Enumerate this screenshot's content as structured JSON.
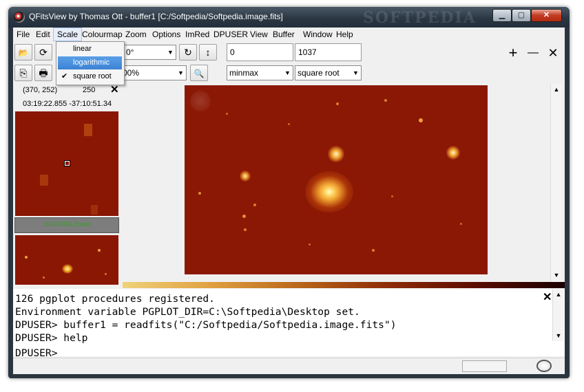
{
  "window": {
    "title": "QFitsView by Thomas Ott - buffer1 [C:/Softpedia/Softpedia.image.fits]",
    "watermark": "SOFTPEDIA",
    "min_glyph": "▁",
    "max_glyph": "▢",
    "close_glyph": "✕"
  },
  "menu": [
    "File",
    "Edit",
    "Scale",
    "Colourmap",
    "Zoom",
    "Options",
    "ImRed",
    "DPUSER",
    "View",
    "Buffer",
    "Window",
    "Help"
  ],
  "scale_menu": {
    "items": [
      "linear",
      "logarithmic",
      "square root"
    ],
    "highlighted": "logarithmic",
    "checked": "square root",
    "check_glyph": "✔"
  },
  "toolbar": {
    "rotation_value": "0°",
    "zoom_value": "00%",
    "min_value": "0",
    "max_value": "1037",
    "scale_mode": "minmax",
    "scale_function": "square root",
    "plus_glyph": "+",
    "minus_glyph": "—",
    "close_glyph": "✕",
    "rotate_glyph": "↻",
    "flip_glyph": "↕",
    "reload_glyph": "⟳",
    "open_glyph": "📂",
    "copy_glyph": "⎘",
    "print_glyph": "🖶",
    "zoom_glyph": "🔍"
  },
  "left_panel": {
    "pixel": "(370, 252)",
    "value": "250",
    "wcs": "03:19:22.855  -37:10:51.34",
    "mini_caption": "1000:800 Zoom"
  },
  "console": {
    "lines": [
      "126 pgplot procedures registered.",
      "Environment variable PGPLOT_DIR=C:\\Softpedia\\Desktop set.",
      "DPUSER> buffer1 = readfits(\"C:/Softpedia/Softpedia.image.fits\")",
      "DPUSER> help",
      "DPUSER>"
    ]
  },
  "colors": {
    "image_bg": "#8b1804",
    "highlight": "#3c82d4"
  }
}
